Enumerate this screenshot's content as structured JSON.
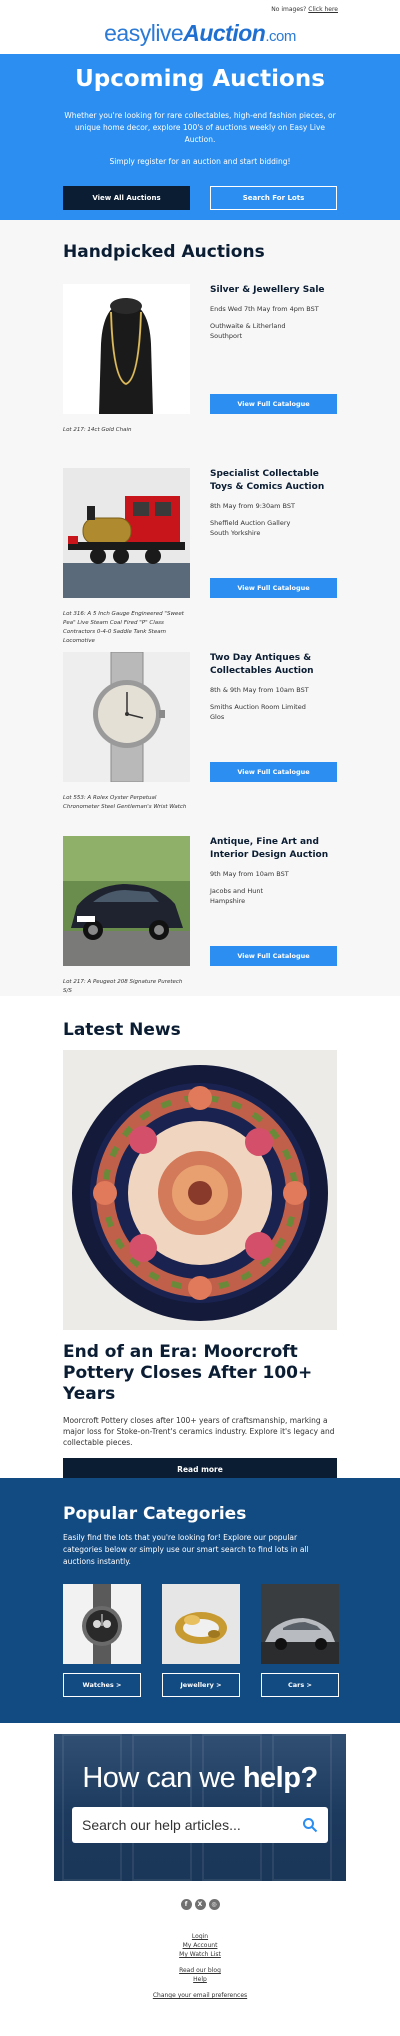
{
  "topbar": {
    "prefix": "No images?",
    "link": "Click here"
  },
  "logo": {
    "part1": "easylive",
    "part2": "Auction",
    "part3": ".com"
  },
  "hero": {
    "title": "Upcoming Auctions",
    "para1": "Whether you're looking for rare collectables, high-end fashion pieces, or unique home decor, explore 100's of auctions weekly on Easy Live Auction.",
    "para2": "Simply register for an auction and start bidding!",
    "btn_all": "View All Auctions",
    "btn_search": "Search For Lots"
  },
  "handpicked": {
    "title": "Handpicked Auctions",
    "button_label": "View Full Catalogue",
    "auctions": [
      {
        "title": "Silver & Jewellery Sale",
        "date": "Ends Wed 7th May from 4pm BST",
        "loc1": "Outhwaite & Litherland",
        "loc2": "Southport",
        "caption": "Lot 217: 14ct Gold Chain"
      },
      {
        "title": "Specialist Collectable Toys & Comics Auction",
        "date": "8th May from 9:30am BST",
        "loc1": "Sheffield Auction Gallery",
        "loc2": "South Yorkshire",
        "caption": "Lot 316: A 5 Inch Gauge Engineered \"Sweet Pea\" Live Steam Coal Fired \"P\" Class Contractors 0-4-0 Saddle Tank Steam Locomotive"
      },
      {
        "title": "Two Day Antiques & Collectables Auction",
        "date": "8th & 9th May from 10am BST",
        "loc1": "Smiths Auction Room Limited",
        "loc2": "Glos",
        "caption": "Lot 553: A Rolex Oyster Perpetual Chronometer Steel Gentleman's Wrist Watch"
      },
      {
        "title": "Antique, Fine Art and Interior Design Auction",
        "date": "9th May from 10am BST",
        "loc1": "Jacobs and Hunt",
        "loc2": "Hampshire",
        "caption": "Lot 217: A Peugeot 208 Signature Puretech S/S"
      }
    ]
  },
  "news": {
    "title": "Latest News",
    "headline": "End of an Era: Moorcroft Pottery Closes After 100+ Years",
    "body": "Moorcroft Pottery closes after 100+ years of craftsmanship, marking a major loss for Stoke-on-Trent's ceramics industry. Explore it's legacy and collectable pieces.",
    "button": "Read more"
  },
  "popular": {
    "title": "Popular Categories",
    "body": "Easily find the lots that you're looking for! Explore our popular categories below or simply use our smart search to find lots in all auctions instantly.",
    "categories": [
      {
        "label": "Watches >"
      },
      {
        "label": "Jewellery >"
      },
      {
        "label": "Cars >"
      }
    ]
  },
  "help": {
    "title_light": "How can we ",
    "title_bold": "help?",
    "search_placeholder": "Search our help articles..."
  },
  "footer": {
    "login": "Login",
    "account": "My Account",
    "watchlist": "My Watch List",
    "blog": "Read our blog",
    "help": "Help",
    "prefs": "Change your email preferences"
  },
  "colors": {
    "primary_blue": "#2b8ef0",
    "navy": "#0b1d33",
    "category_bg": "#124a82"
  }
}
